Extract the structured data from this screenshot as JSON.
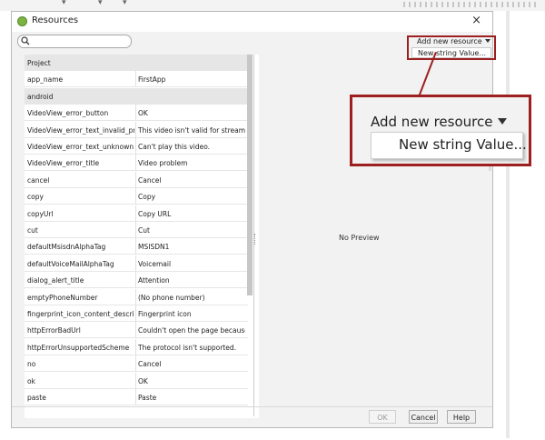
{
  "window": {
    "title": "Resources",
    "close_label": "×"
  },
  "search": {
    "placeholder": ""
  },
  "add_resource": {
    "label": "Add new resource",
    "menu_item": "New string Value..."
  },
  "table": {
    "rows": [
      {
        "type": "group",
        "key": "Project",
        "value": ""
      },
      {
        "type": "item",
        "key": "app_name",
        "value": "FirstApp"
      },
      {
        "type": "group",
        "key": "android",
        "value": ""
      },
      {
        "type": "item",
        "key": "VideoView_error_button",
        "value": "OK"
      },
      {
        "type": "item",
        "key": "VideoView_error_text_invalid_progres",
        "value": "This video isn't valid for streaming..."
      },
      {
        "type": "item",
        "key": "VideoView_error_text_unknown",
        "value": "Can't play this video."
      },
      {
        "type": "item",
        "key": "VideoView_error_title",
        "value": "Video problem"
      },
      {
        "type": "item",
        "key": "cancel",
        "value": "Cancel"
      },
      {
        "type": "item",
        "key": "copy",
        "value": "Copy"
      },
      {
        "type": "item",
        "key": "copyUrl",
        "value": "Copy URL"
      },
      {
        "type": "item",
        "key": "cut",
        "value": "Cut"
      },
      {
        "type": "item",
        "key": "defaultMsisdnAlphaTag",
        "value": "MSISDN1"
      },
      {
        "type": "item",
        "key": "defaultVoiceMailAlphaTag",
        "value": "Voicemail"
      },
      {
        "type": "item",
        "key": "dialog_alert_title",
        "value": "Attention"
      },
      {
        "type": "item",
        "key": "emptyPhoneNumber",
        "value": "(No phone number)"
      },
      {
        "type": "item",
        "key": "fingerprint_icon_content_description",
        "value": "Fingerprint icon"
      },
      {
        "type": "item",
        "key": "httpErrorBadUrl",
        "value": "Couldn't open the page because t..."
      },
      {
        "type": "item",
        "key": "httpErrorUnsupportedScheme",
        "value": "The protocol isn't supported."
      },
      {
        "type": "item",
        "key": "no",
        "value": "Cancel"
      },
      {
        "type": "item",
        "key": "ok",
        "value": "OK"
      },
      {
        "type": "item",
        "key": "paste",
        "value": "Paste"
      }
    ]
  },
  "preview": {
    "text": "No Preview"
  },
  "buttons": {
    "ok": "OK",
    "cancel": "Cancel",
    "help": "Help"
  },
  "colors": {
    "callout": "#9e1f1f",
    "dialog_bg": "#f2f2f2",
    "app_icon": "#7cb342"
  }
}
